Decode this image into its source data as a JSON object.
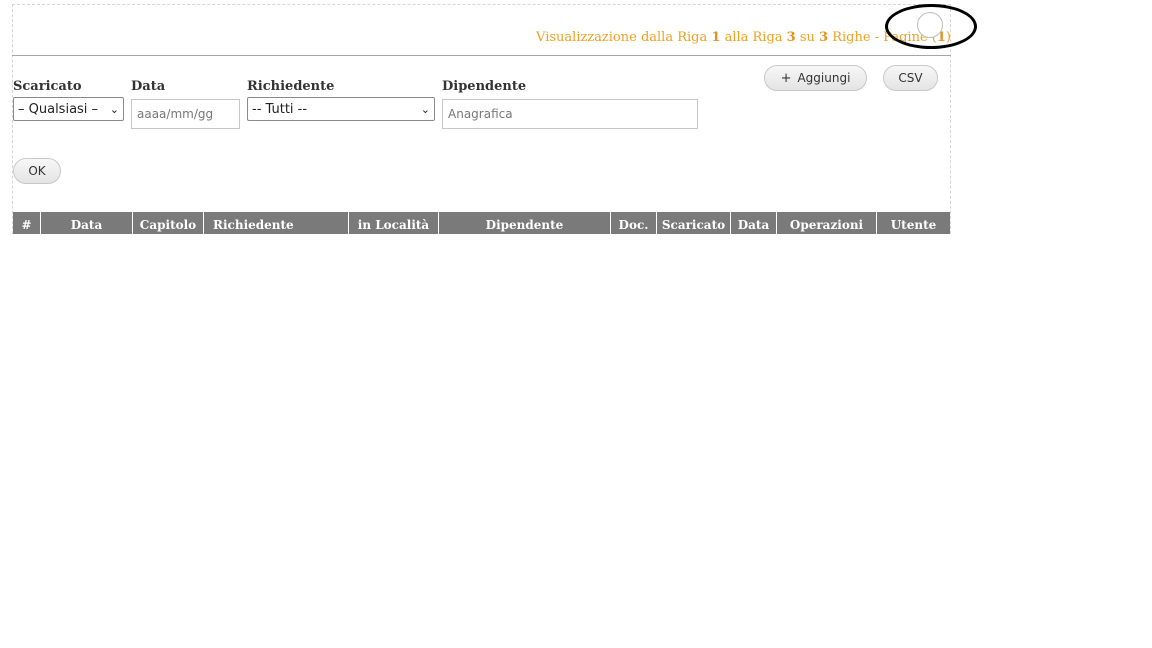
{
  "pagination": {
    "prefix": "Visualizzazione dalla Riga ",
    "row_from": "1",
    "middle": " alla Riga ",
    "row_to": "3",
    "su": " su ",
    "total": "3",
    "suffix": " Righe - Pagine (",
    "page": "1",
    "close": ")"
  },
  "toolbar": {
    "add_label": "Aggiungi",
    "csv_label": "CSV"
  },
  "filters": {
    "scaricato": {
      "label": "Scaricato",
      "value": "– Qualsiasi –"
    },
    "data": {
      "label": "Data",
      "placeholder": "aaaa/mm/gg"
    },
    "richiedente": {
      "label": "Richiedente",
      "value": "-- Tutti --"
    },
    "dipendente": {
      "label": "Dipendente",
      "placeholder": "Anagrafica"
    },
    "ok_label": "OK"
  },
  "table": {
    "headers": [
      "#",
      "Data",
      "Capitolo",
      "Richiedente",
      "in Località",
      "Dipendente",
      "Doc.",
      "Scaricato",
      "Data",
      "Operazioni",
      "Utente"
    ]
  }
}
